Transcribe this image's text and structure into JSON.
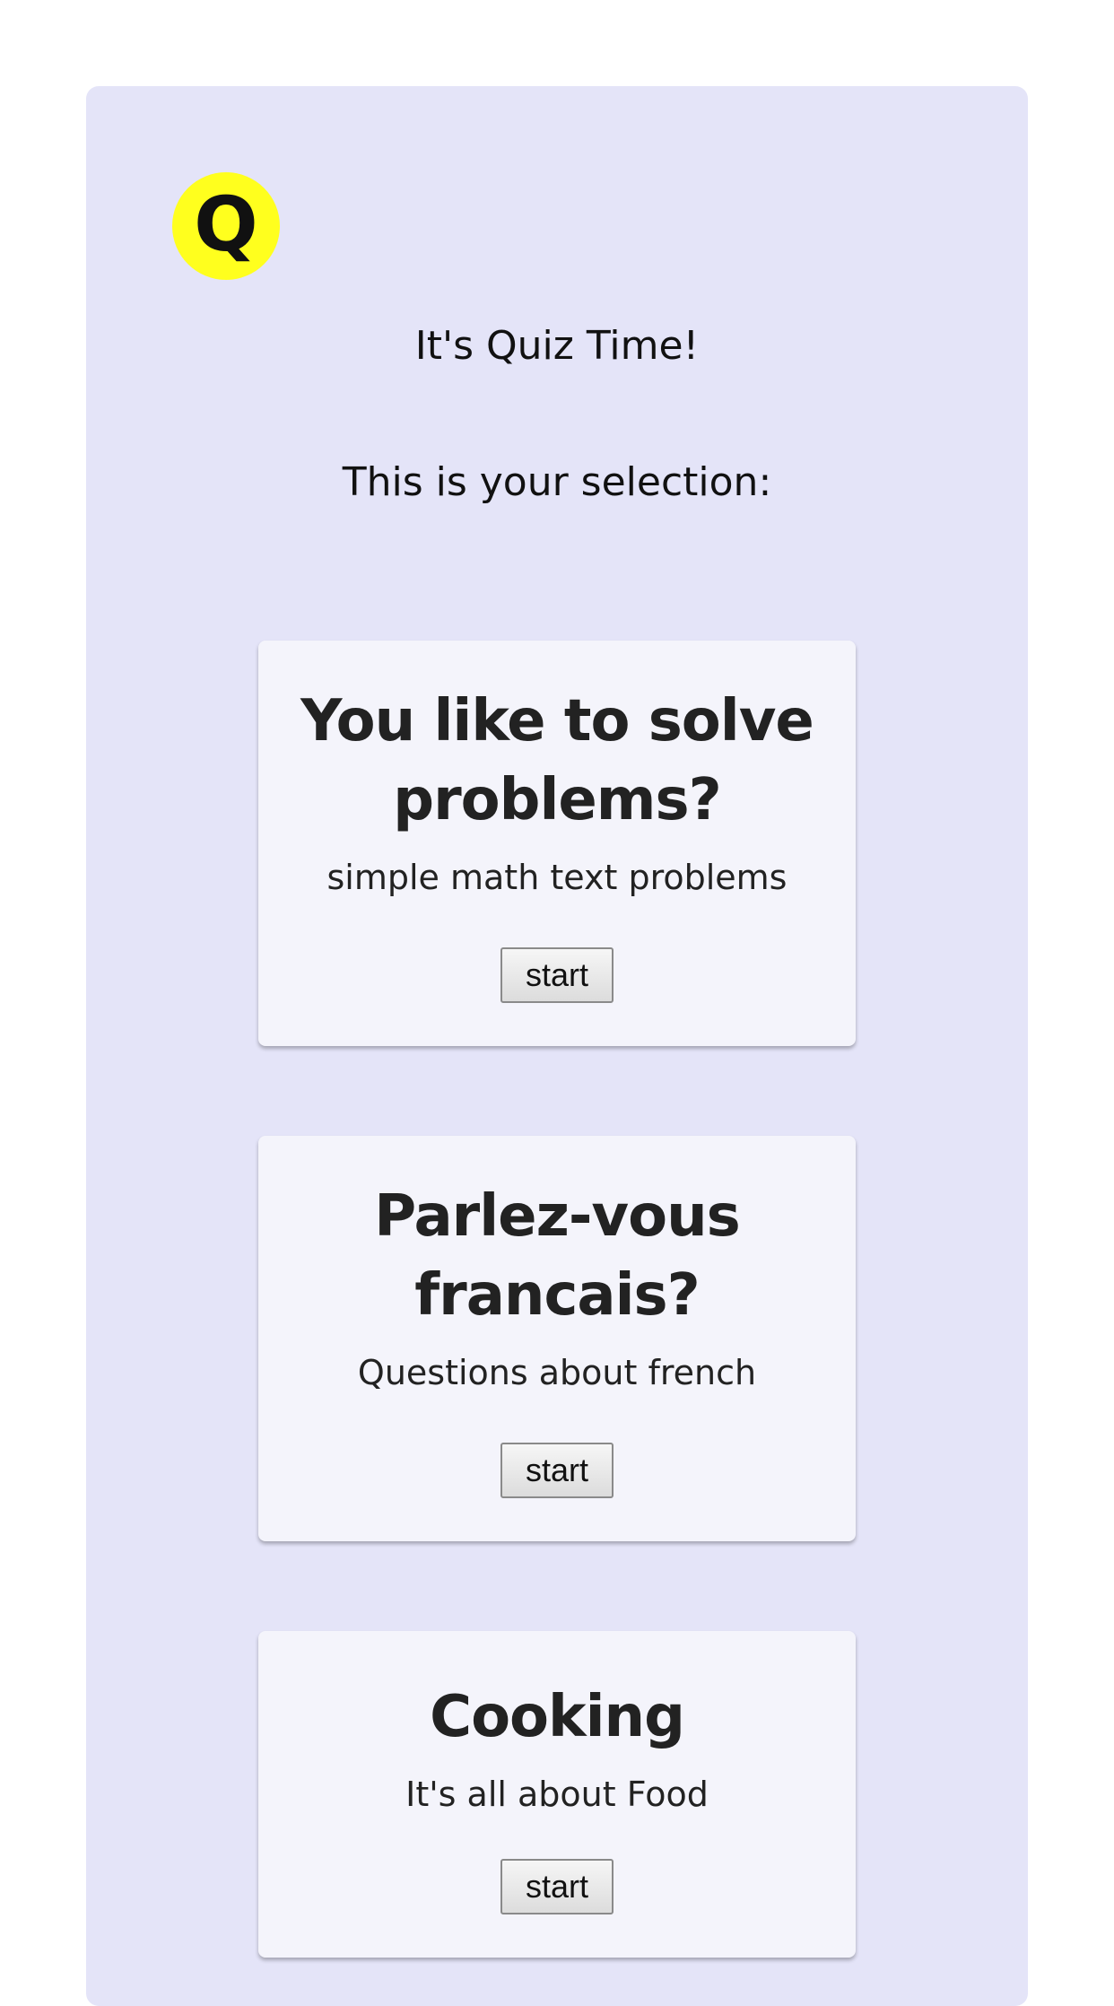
{
  "app": {
    "logo_letter": "Q",
    "title": "It's Quiz Time!",
    "selection_label": "This is your selection:"
  },
  "quizzes": [
    {
      "title": "You like to solve problems?",
      "description": "simple math text problems",
      "button_label": "start"
    },
    {
      "title": "Parlez-vous francais?",
      "description": "Questions about french",
      "button_label": "start"
    },
    {
      "title": "Cooking",
      "description": "It's all about Food",
      "button_label": "start"
    }
  ],
  "colors": {
    "panel_background": "#e4e4f8",
    "card_background": "#f4f4fb",
    "logo_background": "#ffff1e"
  }
}
